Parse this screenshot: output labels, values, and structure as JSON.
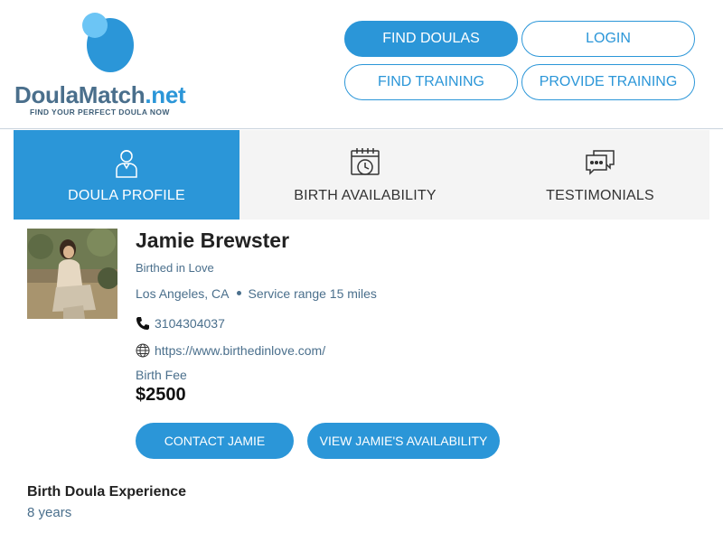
{
  "brand": {
    "name_part1": "Doula",
    "name_part2": "Match",
    "name_part3": ".net",
    "tagline": "FIND YOUR PERFECT DOULA NOW",
    "accent_color": "#2b96d8"
  },
  "nav": {
    "find_doulas": "FIND DOULAS",
    "login": "LOGIN",
    "find_training": "FIND TRAINING",
    "provide_training": "PROVIDE TRAINING"
  },
  "tabs": [
    {
      "label": "DOULA PROFILE",
      "icon": "person-icon",
      "active": true
    },
    {
      "label": "BIRTH AVAILABILITY",
      "icon": "calendar-clock-icon",
      "active": false
    },
    {
      "label": "TESTIMONIALS",
      "icon": "chat-bubbles-icon",
      "active": false
    }
  ],
  "profile": {
    "name": "Jamie Brewster",
    "business": "Birthed in Love",
    "city": "Los Angeles, CA",
    "service_range": "Service range 15 miles",
    "phone": "3104304037",
    "website": "https://www.birthedinlove.com/",
    "fee_label": "Birth Fee",
    "fee_value": "$2500",
    "contact_button": "CONTACT JAMIE",
    "availability_button": "VIEW JAMIE'S AVAILABILITY"
  },
  "experience": {
    "title": "Birth Doula Experience",
    "value": "8 years"
  }
}
